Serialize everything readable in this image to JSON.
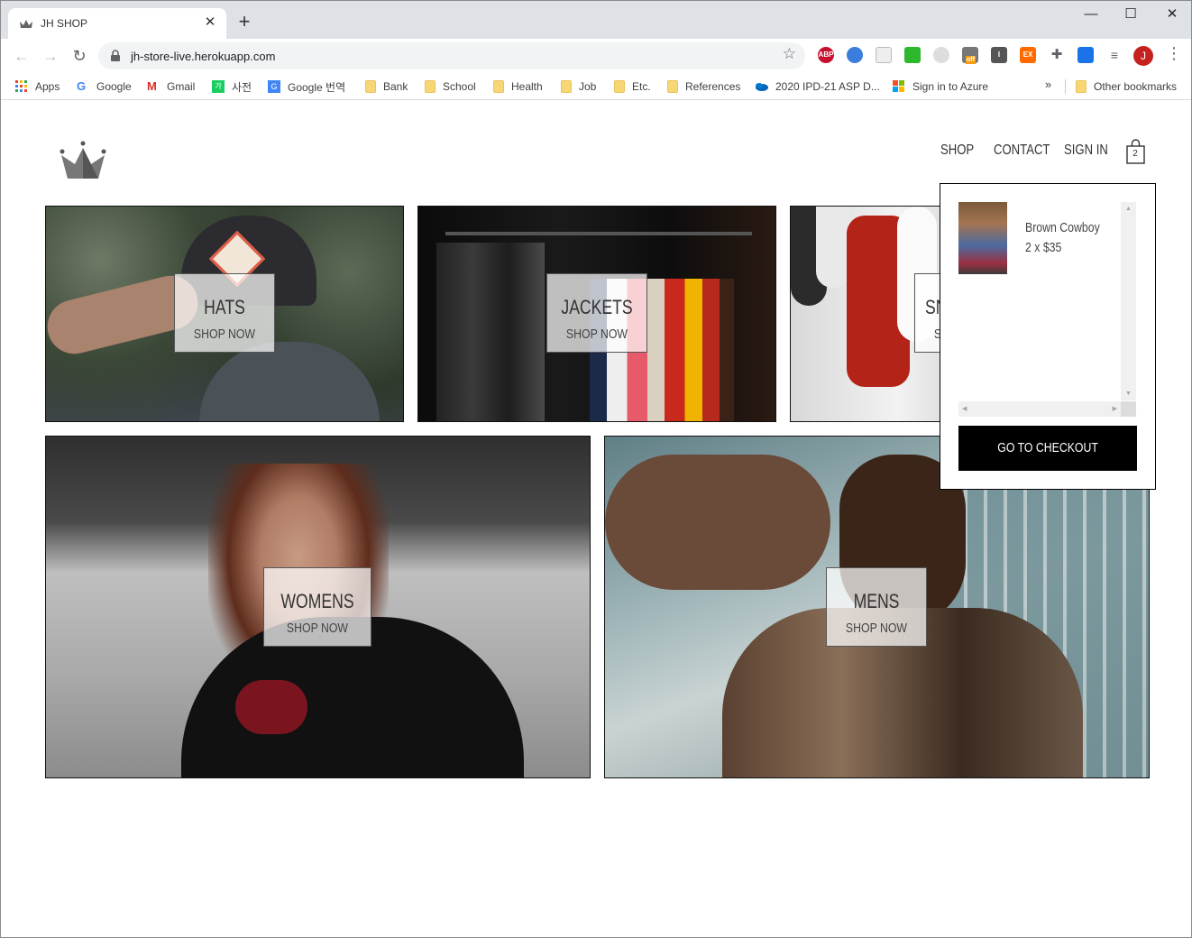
{
  "browser": {
    "tab_title": "JH SHOP",
    "url": "jh-store-live.herokuapp.com",
    "window_controls": [
      "minimize-icon",
      "maximize-icon",
      "close-icon"
    ],
    "bookmarks": [
      {
        "label": "Apps",
        "icon": "apps-grid-icon"
      },
      {
        "label": "Google",
        "icon": "google-icon"
      },
      {
        "label": "Gmail",
        "icon": "gmail-icon"
      },
      {
        "label": "사전",
        "icon": "dictionary-icon"
      },
      {
        "label": "Google 번역",
        "icon": "google-translate-icon"
      },
      {
        "label": "Bank",
        "icon": "folder-icon"
      },
      {
        "label": "School",
        "icon": "folder-icon"
      },
      {
        "label": "Health",
        "icon": "folder-icon"
      },
      {
        "label": "Job",
        "icon": "folder-icon"
      },
      {
        "label": "Etc.",
        "icon": "folder-icon"
      },
      {
        "label": "References",
        "icon": "folder-icon"
      },
      {
        "label": "2020 IPD-21 ASP D...",
        "icon": "onedrive-icon"
      },
      {
        "label": "Sign in to Azure",
        "icon": "microsoft-icon"
      }
    ],
    "other_bookmarks": "Other bookmarks",
    "extensions": [
      "ABP",
      "off"
    ],
    "profile_initial": "J"
  },
  "site": {
    "nav": {
      "shop": "SHOP",
      "contact": "CONTACT",
      "sign_in": "SIGN IN",
      "cart_count": "2"
    },
    "categories": [
      {
        "title": "HATS",
        "cta": "SHOP NOW"
      },
      {
        "title": "JACKETS",
        "cta": "SHOP NOW"
      },
      {
        "title": "SNEAKERS",
        "cta": "SHOP NOW"
      },
      {
        "title": "WOMENS",
        "cta": "SHOP NOW"
      },
      {
        "title": "MENS",
        "cta": "SHOP NOW"
      }
    ],
    "cart_dropdown": {
      "items": [
        {
          "name": "Brown Cowboy",
          "quantity_price": "2 x $35"
        }
      ],
      "checkout_label": "GO TO CHECKOUT"
    }
  }
}
